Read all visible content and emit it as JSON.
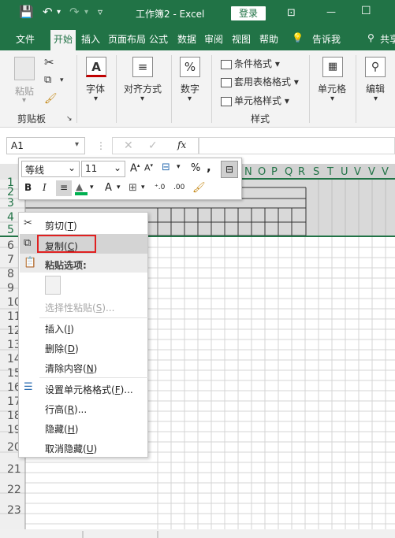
{
  "titlebar": {
    "save_icon": "save-icon",
    "undo_icon": "undo-icon",
    "redo_icon": "redo-icon",
    "qat_icon": "customize-qat-icon",
    "doc_title": "工作簿2  -  Excel",
    "login": "登录",
    "ribbon_display_icon": "ribbon-display-icon",
    "minimize": "—",
    "restore": "☐"
  },
  "tabs": [
    "文件",
    "开始",
    "插入",
    "页面布局",
    "公式",
    "数据",
    "审阅",
    "视图",
    "帮助",
    "告诉我",
    "共享"
  ],
  "ribbon": {
    "clipboard": {
      "paste": "粘贴",
      "group": "剪贴板"
    },
    "font": {
      "label": "字体"
    },
    "align": {
      "label": "对齐方式"
    },
    "number": {
      "label": "数字"
    },
    "styles": {
      "conditional": "条件格式",
      "table": "套用表格格式",
      "cell_styles": "单元格样式",
      "group": "样式"
    },
    "cells": {
      "label": "单元格"
    },
    "editing": {
      "label": "编辑"
    }
  },
  "formula_bar": {
    "namebox": "A1",
    "fx": "fx"
  },
  "columns": [
    "N",
    "O",
    "P",
    "Q",
    "R",
    "S",
    "T",
    "U",
    "V"
  ],
  "rows": [
    "1",
    "2",
    "3",
    "4",
    "5",
    "6",
    "7",
    "8",
    "9",
    "10",
    "11",
    "12",
    "13",
    "14",
    "15",
    "16",
    "17",
    "18",
    "19",
    "20",
    "21",
    "22",
    "23"
  ],
  "mini_toolbar": {
    "font_name": "等线",
    "font_size": "11",
    "percent": "%",
    "comma": ",",
    "bold": "B",
    "italic": "I",
    "font_color_letter": "A"
  },
  "context_menu": {
    "cut": "剪切(",
    "cut_key": "T",
    "copy": "复制(",
    "copy_key": "C",
    "paste_options": "粘贴选项:",
    "paste_special": "选择性粘贴(",
    "paste_special_key": "S",
    "insert": "插入(",
    "insert_key": "I",
    "delete": "删除(",
    "delete_key": "D",
    "clear": "清除内容(",
    "clear_key": "N",
    "format_cells": "设置单元格格式(",
    "format_cells_key": "F",
    "row_height": "行高(",
    "row_height_key": "R",
    "hide": "隐藏(",
    "hide_key": "H",
    "unhide": "取消隐藏(",
    "unhide_key": "U"
  },
  "colors": {
    "excel_green": "#217346",
    "highlight_red": "#e02020"
  }
}
